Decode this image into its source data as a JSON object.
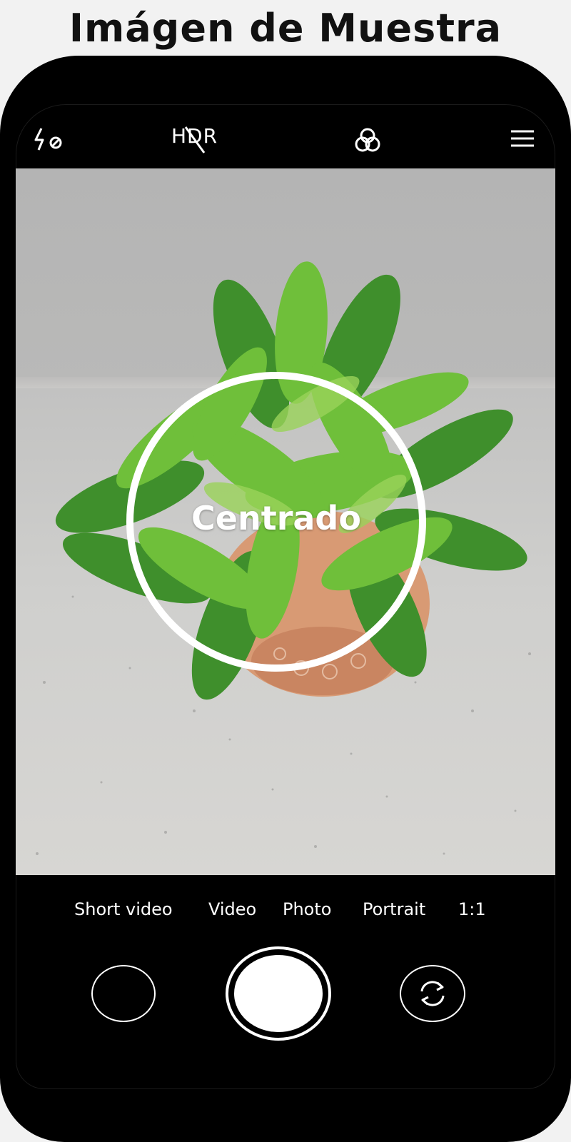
{
  "page": {
    "title": "Imágen de Muestra"
  },
  "camera": {
    "topbar": {
      "flash_icon": "flash-off-icon",
      "hdr_label": "HDR",
      "filters_icon": "filters-icon",
      "menu_icon": "menu-icon"
    },
    "viewfinder": {
      "focus_label": "Centrado"
    },
    "modes": [
      "Short video",
      "Video",
      "Photo",
      "Portrait",
      "1:1"
    ],
    "controls": {
      "gallery_icon": "gallery-thumbnail",
      "shutter_icon": "shutter-button",
      "flip_icon": "switch-camera-icon"
    }
  },
  "colors": {
    "background": "#f2f2f2",
    "phone_body": "#000000",
    "ui_foreground": "#ffffff",
    "leaf_green": "#6fbf3a",
    "pot": "#d89a74"
  }
}
